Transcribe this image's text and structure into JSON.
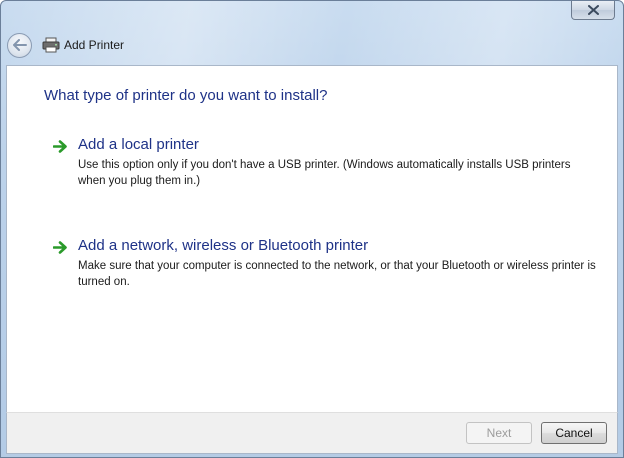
{
  "window": {
    "title": "Add Printer",
    "close_icon": "close-x-icon",
    "back_icon": "back-arrow-icon",
    "app_icon": "printer-icon"
  },
  "main": {
    "heading": "What type of printer do you want to install?",
    "options": [
      {
        "title": "Add a local printer",
        "description": "Use this option only if you don't have a USB printer. (Windows automatically installs USB printers when you plug them in.)",
        "icon": "green-arrow-icon"
      },
      {
        "title": "Add a network, wireless or Bluetooth printer",
        "description": "Make sure that your computer is connected to the network, or that your Bluetooth or wireless printer is turned on.",
        "icon": "green-arrow-icon"
      }
    ]
  },
  "footer": {
    "next_label": "Next",
    "cancel_label": "Cancel"
  },
  "colors": {
    "heading": "#1e3287",
    "arrow": "#2a9a2a",
    "frame": "#bcd2ea"
  }
}
